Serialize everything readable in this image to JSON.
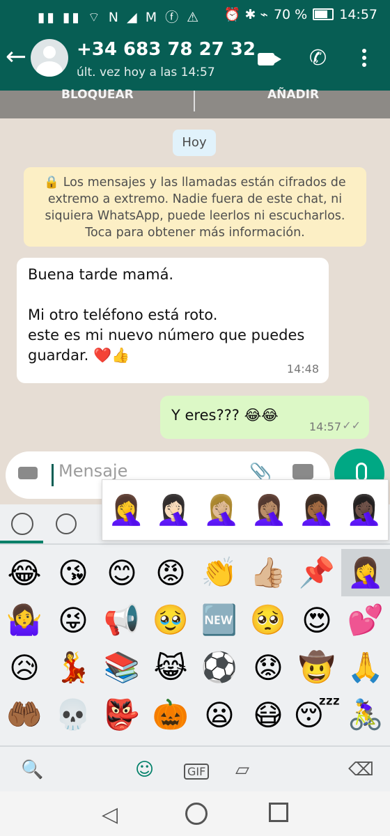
{
  "status_bar": {
    "left_icons": "▮▮ ▮▮ ⌔ N ◢ M ⓕ ⚠",
    "right_icons": "⏰ ✱ ⌁",
    "battery": "70 %",
    "time": "14:57"
  },
  "header": {
    "contact": "+34 683 78 27 32",
    "last_seen": "últ. vez hoy a las 14:57"
  },
  "actions": {
    "block": "BLOQUEAR",
    "add": "AÑADIR"
  },
  "chat": {
    "date": "Hoy",
    "encryption": "🔒 Los mensajes y las llamadas están cifrados de extremo a extremo. Nadie fuera de este chat, ni siquiera WhatsApp, puede leerlos ni escucharlos. Toca para obtener más información.",
    "incoming": {
      "line1": "Buena tarde mamá.",
      "line2": "Mi otro teléfono está roto.",
      "line3": "este es mi nuevo número que puedes",
      "line4": "guardar. ❤️👍",
      "time": "14:48"
    },
    "outgoing": {
      "text": "Y eres??? 😂😂",
      "time": "14:57",
      "ticks": "✓✓"
    }
  },
  "input": {
    "placeholder": "Mensaje"
  },
  "skin_tones": [
    "🤦‍♀️",
    "🤦🏻‍♀️",
    "🤦🏼‍♀️",
    "🤦🏽‍♀️",
    "🤦🏾‍♀️",
    "🤦🏿‍♀️"
  ],
  "emoji_rows": [
    [
      "😂",
      "😘",
      "😊",
      "😡",
      "👏",
      "👍🏼",
      "📌",
      "🤦‍♀️"
    ],
    [
      "🤷‍♀️",
      "😜",
      "📢",
      "🥹",
      "🆕",
      "🥺",
      "😍",
      "💕"
    ],
    [
      "😥",
      "💃",
      "📚",
      "😹",
      "⚽",
      "😟",
      "🤠",
      "🙏"
    ],
    [
      "🤲🏾",
      "💀",
      "👺",
      "🎃",
      "😦",
      "😷",
      "😴",
      "🚴‍♀️"
    ]
  ],
  "keyboard_bottom": {
    "search": "🔍",
    "emoji": "☺",
    "gif": "GIF",
    "sticker": "▱",
    "backspace": "⌫"
  },
  "nav": {
    "back": "◁"
  }
}
